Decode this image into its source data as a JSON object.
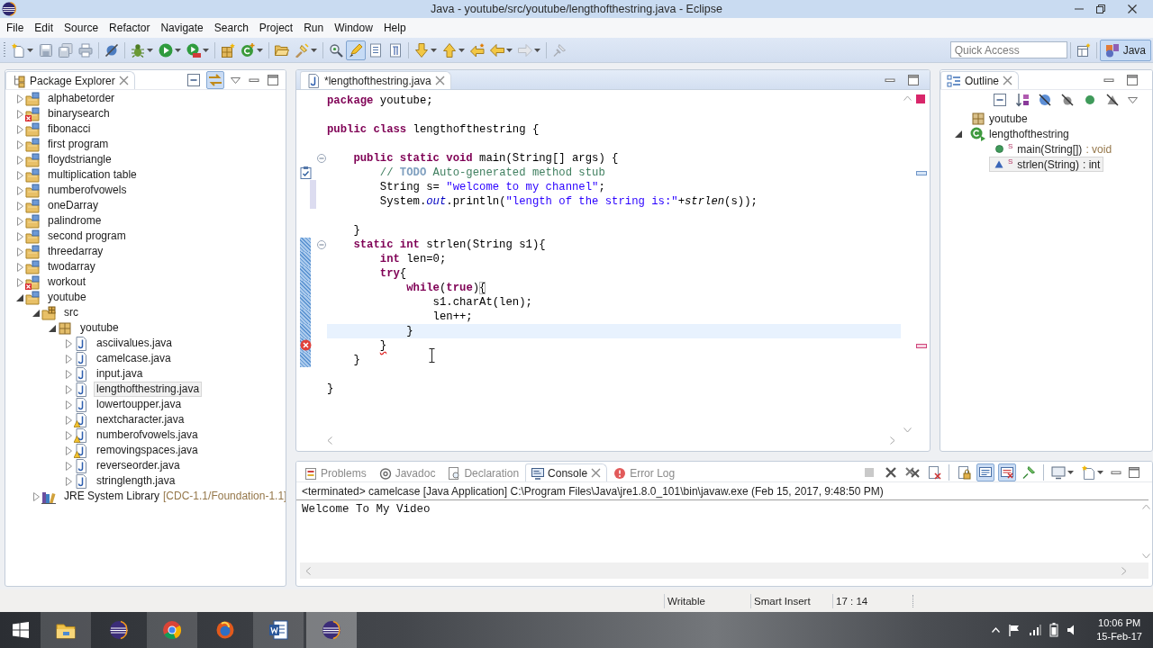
{
  "window": {
    "title": "Java - youtube/src/youtube/lengthofthestring.java - Eclipse"
  },
  "menu": [
    "File",
    "Edit",
    "Source",
    "Refactor",
    "Navigate",
    "Search",
    "Project",
    "Run",
    "Window",
    "Help"
  ],
  "toolbar": {
    "mark_occurrences": true,
    "quick_access": {
      "placeholder": "Quick Access"
    },
    "perspectives": [
      {
        "label": "Java",
        "selected": true
      }
    ]
  },
  "package_explorer": {
    "title": "Package Explorer",
    "link_with_editor": true,
    "tree": [
      {
        "label": "alphabetorder",
        "kind": "project",
        "expanded": false,
        "selected": false
      },
      {
        "label": "binarysearch",
        "kind": "project",
        "expanded": false,
        "selected": false,
        "error": true
      },
      {
        "label": "fibonacci",
        "kind": "project",
        "expanded": false,
        "selected": false
      },
      {
        "label": "first program",
        "kind": "project",
        "expanded": false,
        "selected": false
      },
      {
        "label": "floydstriangle",
        "kind": "project",
        "expanded": false,
        "selected": false
      },
      {
        "label": "multiplication table",
        "kind": "project",
        "expanded": false,
        "selected": false
      },
      {
        "label": "numberofvowels",
        "kind": "project",
        "expanded": false,
        "selected": false
      },
      {
        "label": "oneDarray",
        "kind": "project",
        "expanded": false,
        "selected": false
      },
      {
        "label": "palindrome",
        "kind": "project",
        "expanded": false,
        "selected": false
      },
      {
        "label": "second program",
        "kind": "project",
        "expanded": false,
        "selected": false
      },
      {
        "label": "threedarray",
        "kind": "project",
        "expanded": false,
        "selected": false
      },
      {
        "label": "twodarray",
        "kind": "project",
        "expanded": false,
        "selected": false
      },
      {
        "label": "workout",
        "kind": "project",
        "expanded": false,
        "selected": false,
        "error": true
      },
      {
        "label": "youtube",
        "kind": "project",
        "expanded": true,
        "selected": false,
        "children": [
          {
            "label": "src",
            "kind": "source_folder",
            "expanded": true,
            "selected": false,
            "children": [
              {
                "label": "youtube",
                "kind": "package",
                "expanded": true,
                "selected": false,
                "children": [
                  {
                    "label": "asciivalues.java",
                    "kind": "java_file",
                    "expanded": false,
                    "selected": false
                  },
                  {
                    "label": "camelcase.java",
                    "kind": "java_file",
                    "expanded": false,
                    "selected": false
                  },
                  {
                    "label": "input.java",
                    "kind": "java_file",
                    "expanded": false,
                    "selected": false
                  },
                  {
                    "label": "lengthofthestring.java",
                    "kind": "java_file",
                    "expanded": false,
                    "selected": true
                  },
                  {
                    "label": "lowertoupper.java",
                    "kind": "java_file",
                    "expanded": false,
                    "selected": false
                  },
                  {
                    "label": "nextcharacter.java",
                    "kind": "java_file",
                    "expanded": false,
                    "selected": false,
                    "warning": true
                  },
                  {
                    "label": "numberofvowels.java",
                    "kind": "java_file",
                    "expanded": false,
                    "selected": false,
                    "warning": true
                  },
                  {
                    "label": "removingspaces.java",
                    "kind": "java_file",
                    "expanded": false,
                    "selected": false,
                    "warning": true
                  },
                  {
                    "label": "reverseorder.java",
                    "kind": "java_file",
                    "expanded": false,
                    "selected": false
                  },
                  {
                    "label": "stringlength.java",
                    "kind": "java_file",
                    "expanded": false,
                    "selected": false
                  }
                ]
              }
            ]
          },
          {
            "label": "JRE System Library",
            "decoration": "[CDC-1.1/Foundation-1.1]",
            "kind": "library",
            "expanded": false,
            "selected": false
          }
        ]
      }
    ]
  },
  "editor": {
    "tab": {
      "label": "*lengthofthestring.java",
      "selected": true
    },
    "lines": [
      {
        "kind": "code",
        "current": false,
        "tokens": [
          {
            "text": "package",
            "kind": "keyword"
          },
          {
            "text": " youtube;",
            "kind": "plain"
          }
        ]
      },
      {
        "kind": "blank",
        "current": false
      },
      {
        "kind": "code",
        "current": false,
        "tokens": [
          {
            "text": "public class",
            "kind": "keyword"
          },
          {
            "text": " lengthofthestring {",
            "kind": "plain"
          }
        ],
        "children": [
          {
            "kind": "blank",
            "current": false
          },
          {
            "kind": "code",
            "current": false,
            "expanded": true,
            "tokens": [
              {
                "text": "public static void",
                "kind": "keyword"
              },
              {
                "text": " main(String[] args) {",
                "kind": "plain"
              }
            ],
            "children": [
              {
                "kind": "code",
                "current": false,
                "task": true,
                "tokens": [
                  {
                    "text": "// ",
                    "kind": "comment"
                  },
                  {
                    "text": "TODO",
                    "kind": "todo"
                  },
                  {
                    "text": " Auto-generated method stub",
                    "kind": "comment"
                  }
                ]
              },
              {
                "kind": "code",
                "current": false,
                "changed": true,
                "tokens": [
                  {
                    "text": "String s= ",
                    "kind": "plain"
                  },
                  {
                    "text": "\"welcome to my channel\"",
                    "kind": "string"
                  },
                  {
                    "text": ";",
                    "kind": "plain"
                  }
                ]
              },
              {
                "kind": "code",
                "current": false,
                "changed": true,
                "tokens": [
                  {
                    "text": "System.",
                    "kind": "plain"
                  },
                  {
                    "text": "out",
                    "kind": "field"
                  },
                  {
                    "text": ".println(",
                    "kind": "plain"
                  },
                  {
                    "text": "\"length of the string is:\"",
                    "kind": "string"
                  },
                  {
                    "text": "+",
                    "kind": "plain"
                  },
                  {
                    "text": "strlen",
                    "kind": "method"
                  },
                  {
                    "text": "(s));",
                    "kind": "plain"
                  }
                ]
              },
              {
                "kind": "blank",
                "current": false
              }
            ]
          },
          {
            "kind": "code",
            "current": false,
            "tokens": [
              {
                "text": "}",
                "kind": "plain"
              }
            ]
          },
          {
            "kind": "code",
            "current": false,
            "expanded": true,
            "added": true,
            "tokens": [
              {
                "text": "static int",
                "kind": "keyword"
              },
              {
                "text": " strlen(String s1){",
                "kind": "plain"
              }
            ],
            "children": [
              {
                "kind": "code",
                "current": false,
                "added": true,
                "tokens": [
                  {
                    "text": "int",
                    "kind": "keyword"
                  },
                  {
                    "text": " len=0;",
                    "kind": "plain"
                  }
                ]
              },
              {
                "kind": "code",
                "current": false,
                "added": true,
                "tokens": [
                  {
                    "text": "try",
                    "kind": "keyword"
                  },
                  {
                    "text": "{",
                    "kind": "plain"
                  }
                ],
                "children": [
                  {
                    "kind": "code",
                    "current": false,
                    "added": true,
                    "tokens": [
                      {
                        "text": "while",
                        "kind": "keyword"
                      },
                      {
                        "text": "(",
                        "kind": "plain"
                      },
                      {
                        "text": "true",
                        "kind": "keyword"
                      },
                      {
                        "text": ")",
                        "kind": "plain"
                      },
                      {
                        "text": "{",
                        "kind": "bracket"
                      }
                    ],
                    "children": [
                      {
                        "kind": "code",
                        "current": false,
                        "added": true,
                        "tokens": [
                          {
                            "text": "s1.charAt(len);",
                            "kind": "plain"
                          }
                        ]
                      },
                      {
                        "kind": "code",
                        "current": false,
                        "added": true,
                        "tokens": [
                          {
                            "text": "len++;",
                            "kind": "plain"
                          }
                        ]
                      }
                    ]
                  },
                  {
                    "kind": "code",
                    "current": true,
                    "added": true,
                    "tokens": [
                      {
                        "text": "}",
                        "kind": "plain"
                      }
                    ]
                  }
                ]
              },
              {
                "kind": "code",
                "current": false,
                "added": true,
                "error": true,
                "tokens": [
                  {
                    "text": "}",
                    "kind": "error"
                  }
                ]
              }
            ]
          },
          {
            "kind": "code",
            "current": false,
            "added": true,
            "tokens": [
              {
                "text": "}",
                "kind": "plain"
              }
            ]
          },
          {
            "kind": "blank",
            "current": false
          }
        ]
      },
      {
        "kind": "code",
        "current": false,
        "tokens": [
          {
            "text": "}",
            "kind": "plain"
          }
        ]
      }
    ]
  },
  "outline": {
    "title": "Outline",
    "tree": [
      {
        "label": "youtube",
        "kind": "package",
        "selected": false
      },
      {
        "label": "lengthofthestring",
        "kind": "class",
        "expanded": true,
        "selected": false,
        "children": [
          {
            "label": "main(String[])",
            "type": ": void",
            "badge": "S",
            "kind": "public_method",
            "selected": false
          },
          {
            "label": "strlen(String)",
            "type": ": int",
            "badge": "S",
            "kind": "default_method",
            "selected": true
          }
        ]
      }
    ]
  },
  "bottom_panel": {
    "tabs": [
      {
        "label": "Problems",
        "selected": false
      },
      {
        "label": "Javadoc",
        "selected": false
      },
      {
        "label": "Declaration",
        "selected": false
      },
      {
        "label": "Console",
        "selected": true
      },
      {
        "label": "Error Log",
        "selected": false
      }
    ],
    "show_on_stdout": true,
    "show_on_stderr": true,
    "console": {
      "header": "<terminated> camelcase [Java Application] C:\\Program Files\\Java\\jre1.8.0_101\\bin\\javaw.exe (Feb 15, 2017, 9:48:50 PM)",
      "output": "Welcome To My Video"
    }
  },
  "status_bar": {
    "items": [
      "Writable",
      "Smart Insert",
      "17 : 14"
    ]
  },
  "taskbar": {
    "apps": [
      {
        "running": true,
        "selected": false
      },
      {
        "running": false,
        "selected": false
      },
      {
        "running": true,
        "selected": false
      },
      {
        "running": false,
        "selected": false
      },
      {
        "running": true,
        "selected": false
      },
      {
        "running": true,
        "selected": true
      }
    ],
    "clock": {
      "time": "10:06 PM",
      "date": "15-Feb-17"
    }
  }
}
